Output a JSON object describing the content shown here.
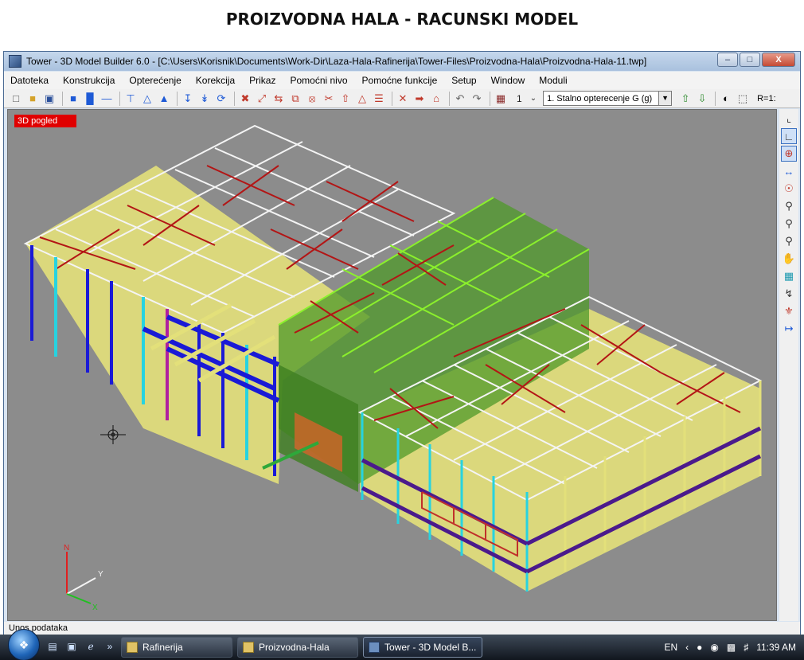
{
  "document": {
    "heading": "PROIZVODNA HALA - RACUNSKI MODEL"
  },
  "window": {
    "title": "Tower - 3D Model Builder 6.0 - [C:\\Users\\Korisnik\\Documents\\Work-Dir\\Laza-Hala-Rafinerija\\Tower-Files\\Proizvodna-Hala\\Proizvodna-Hala-11.twp]",
    "buttons": {
      "minimize": "–",
      "maximize": "□",
      "close": "X"
    }
  },
  "menu": {
    "items": [
      "Datoteka",
      "Konstrukcija",
      "Opterećenje",
      "Korekcija",
      "Prikaz",
      "Pomoćni nivo",
      "Pomoćne funkcije",
      "Setup",
      "Window",
      "Moduli"
    ]
  },
  "toolbar": {
    "load_case_number": "1",
    "load_case_selected": "1. Stalno opterecenje G (g)",
    "ratio_label": "R=1:"
  },
  "viewport": {
    "badge": "3D pogled",
    "axes": {
      "z": "N",
      "y": "Y",
      "x": "X"
    }
  },
  "status": {
    "text": "Unos podataka"
  },
  "taskbar": {
    "buttons": [
      {
        "label": "Rafinerija"
      },
      {
        "label": "Proizvodna-Hala"
      },
      {
        "label": "Tower - 3D Model B..."
      }
    ],
    "language": "EN",
    "clock": "11:39 AM"
  },
  "colors": {
    "viewport_bg": "#8c8c8c",
    "floor": "#e3e07a",
    "column_cyan": "#27d3e0",
    "beam_blue": "#1a1ad6",
    "brace_red": "#b31515",
    "truss_white": "#f4f4f4",
    "truss_green": "#8bf02c",
    "wall_green": "#4f9a2a",
    "beam_purple": "#4b1a8c",
    "badge_red": "#e00000"
  }
}
